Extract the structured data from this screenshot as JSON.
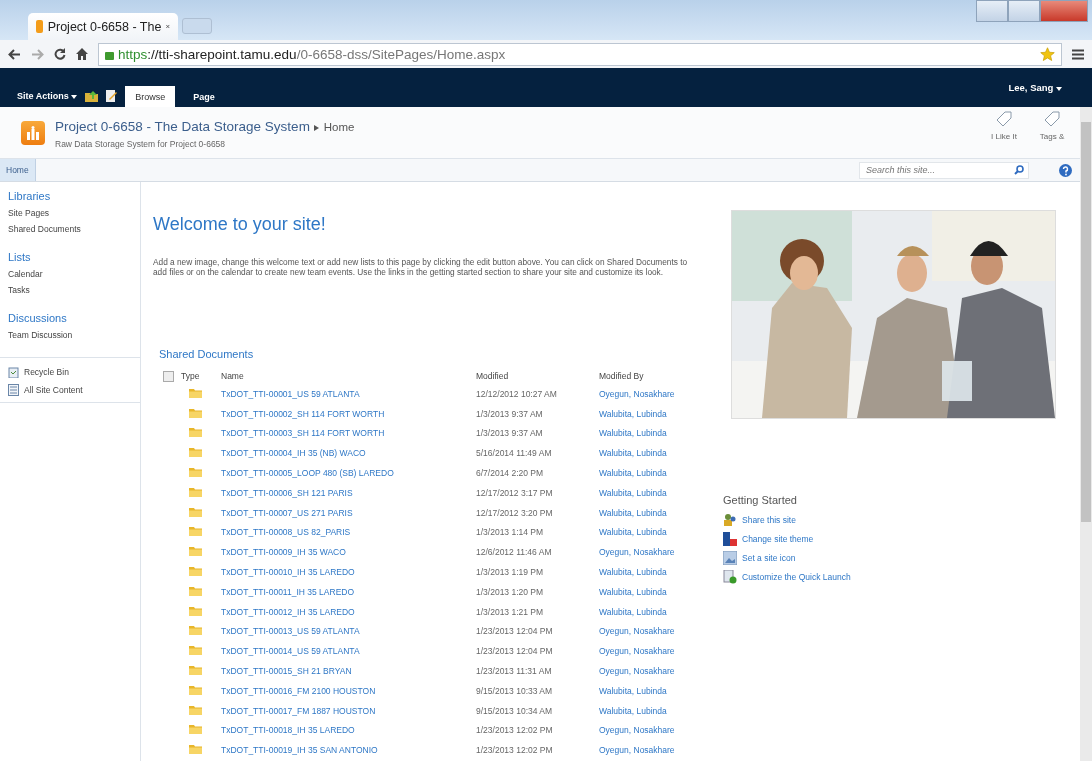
{
  "browser": {
    "tab_title": "Project 0-6658 - The",
    "url": {
      "scheme": "https",
      "host": "://tti-sharepoint.tamu.edu",
      "path": "/0-6658-dss/SitePages/Home.aspx"
    }
  },
  "ribbon": {
    "site_actions": "Site Actions",
    "tabs": [
      {
        "label": "Browse",
        "selected": true
      },
      {
        "label": "Page",
        "selected": false
      }
    ],
    "user": "Lee, Sang"
  },
  "site": {
    "title": "Project 0-6658 - The Data Storage System",
    "breadcrumb": "Home",
    "description": "Raw Data Storage System for Project 0-6658",
    "social": [
      "I Like It",
      "Tags &"
    ]
  },
  "top_nav": {
    "items": [
      {
        "label": "Home",
        "selected": true
      }
    ],
    "search": {
      "placeholder": "Search this site..."
    }
  },
  "sidebar": {
    "groups": [
      {
        "heading": "Libraries",
        "items": [
          "Site Pages",
          "Shared Documents"
        ]
      },
      {
        "heading": "Lists",
        "items": [
          "Calendar",
          "Tasks"
        ]
      },
      {
        "heading": "Discussions",
        "items": [
          "Team Discussion"
        ]
      }
    ],
    "footer": [
      {
        "label": "Recycle Bin",
        "kind": "recycle"
      },
      {
        "label": "All Site Content",
        "kind": "content"
      }
    ]
  },
  "main": {
    "heading": "Welcome to your site!",
    "intro": "Add a new image, change this welcome text or add new lists to this page by clicking the edit button above. You can click on Shared Documents to add files or on the calendar to create new team events. Use the links in the getting started section to share your site and customize its look.",
    "library": {
      "title": "Shared Documents",
      "select_all": {
        "checked": false
      },
      "columns": [
        "Type",
        "Name",
        "Modified",
        "Modified By"
      ],
      "rows": [
        {
          "name": "TxDOT_TTI-00001_US 59 ATLANTA",
          "modified": "12/12/2012 10:27 AM",
          "modified_by": "Oyegun, Nosakhare"
        },
        {
          "name": "TxDOT_TTI-00002_SH 114 FORT WORTH",
          "modified": "1/3/2013 9:37 AM",
          "modified_by": "Walubita, Lubinda"
        },
        {
          "name": "TxDOT_TTI-00003_SH 114 FORT WORTH",
          "modified": "1/3/2013 9:37 AM",
          "modified_by": "Walubita, Lubinda"
        },
        {
          "name": "TxDOT_TTI-00004_IH 35 (NB) WACO",
          "modified": "5/16/2014 11:49 AM",
          "modified_by": "Walubita, Lubinda"
        },
        {
          "name": "TxDOT_TTI-00005_LOOP 480 (SB) LAREDO",
          "modified": "6/7/2014 2:20 PM",
          "modified_by": "Walubita, Lubinda"
        },
        {
          "name": "TxDOT_TTI-00006_SH 121 PARIS",
          "modified": "12/17/2012 3:17 PM",
          "modified_by": "Walubita, Lubinda"
        },
        {
          "name": "TxDOT_TTI-00007_US 271 PARIS",
          "modified": "12/17/2012 3:20 PM",
          "modified_by": "Walubita, Lubinda"
        },
        {
          "name": "TxDOT_TTI-00008_US 82_PARIS",
          "modified": "1/3/2013 1:14 PM",
          "modified_by": "Walubita, Lubinda"
        },
        {
          "name": "TxDOT_TTI-00009_IH 35 WACO",
          "modified": "12/6/2012 11:46 AM",
          "modified_by": "Oyegun, Nosakhare"
        },
        {
          "name": "TxDOT_TTI-00010_IH 35 LAREDO",
          "modified": "1/3/2013 1:19 PM",
          "modified_by": "Walubita, Lubinda"
        },
        {
          "name": "TxDOT_TTI-00011_IH 35 LAREDO",
          "modified": "1/3/2013 1:20 PM",
          "modified_by": "Walubita, Lubinda"
        },
        {
          "name": "TxDOT_TTI-00012_IH 35 LAREDO",
          "modified": "1/3/2013 1:21 PM",
          "modified_by": "Walubita, Lubinda"
        },
        {
          "name": "TxDOT_TTI-00013_US 59 ATLANTA",
          "modified": "1/23/2013 12:04 PM",
          "modified_by": "Oyegun, Nosakhare"
        },
        {
          "name": "TxDOT_TTI-00014_US 59 ATLANTA",
          "modified": "1/23/2013 12:04 PM",
          "modified_by": "Oyegun, Nosakhare"
        },
        {
          "name": "TxDOT_TTI-00015_SH 21 BRYAN",
          "modified": "1/23/2013 11:31 AM",
          "modified_by": "Oyegun, Nosakhare"
        },
        {
          "name": "TxDOT_TTI-00016_FM 2100 HOUSTON",
          "modified": "9/15/2013 10:33 AM",
          "modified_by": "Walubita, Lubinda"
        },
        {
          "name": "TxDOT_TTI-00017_FM 1887 HOUSTON",
          "modified": "9/15/2013 10:34 AM",
          "modified_by": "Walubita, Lubinda"
        },
        {
          "name": "TxDOT_TTI-00018_IH 35 LAREDO",
          "modified": "1/23/2013 12:02 PM",
          "modified_by": "Oyegun, Nosakhare"
        },
        {
          "name": "TxDOT_TTI-00019_IH 35 SAN ANTONIO",
          "modified": "1/23/2013 12:02 PM",
          "modified_by": "Oyegun, Nosakhare"
        }
      ]
    }
  },
  "side_panel": {
    "getting_started": {
      "title": "Getting Started",
      "links": [
        {
          "label": "Share this site",
          "kind": "share"
        },
        {
          "label": "Change site theme",
          "kind": "theme"
        },
        {
          "label": "Set a site icon",
          "kind": "icon"
        },
        {
          "label": "Customize the Quick Launch",
          "kind": "launch"
        }
      ]
    }
  }
}
